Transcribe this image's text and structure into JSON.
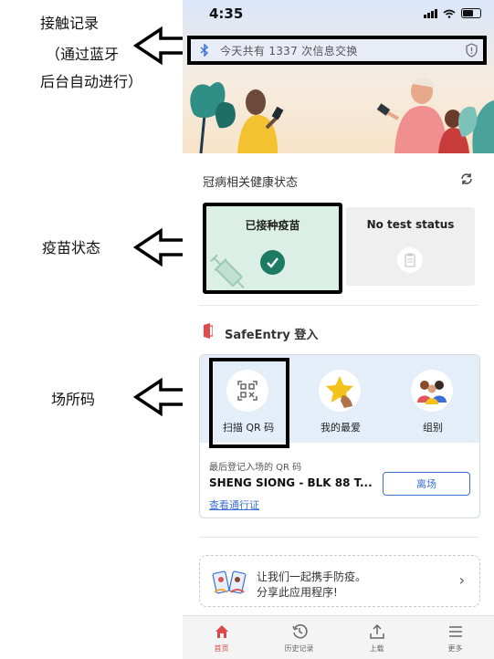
{
  "annotations": {
    "contact_line1": "接触记录",
    "contact_line2": "（通过蓝牙",
    "contact_line3": "后台自动进行）",
    "vaccine": "疫苗状态",
    "venue": "场所码"
  },
  "statusbar": {
    "time": "4:35"
  },
  "exchange": {
    "text": "今天共有 1337 次信息交换"
  },
  "health": {
    "title": "冠病相关健康状态",
    "vaccinated_label": "已接种疫苗",
    "test_label": "No test status"
  },
  "safeentry": {
    "title": "SafeEntry 登入",
    "items": [
      {
        "label": "扫描 QR 码"
      },
      {
        "label": "我的最爱"
      },
      {
        "label": "组别"
      }
    ],
    "last_label": "最后登记入场的 QR 码",
    "last_place": "SHENG SIONG - BLK 88 T...",
    "leave_button": "离场",
    "pass_link": "查看通行证"
  },
  "share": {
    "line1": "让我们一起携手防疫。",
    "line2": "分享此应用程序!",
    "chevron": "›"
  },
  "tabbar": {
    "items": [
      {
        "label": "首页",
        "icon": "home-icon"
      },
      {
        "label": "历史记录",
        "icon": "history-icon"
      },
      {
        "label": "上载",
        "icon": "upload-icon"
      },
      {
        "label": "更多",
        "icon": "menu-icon"
      }
    ]
  },
  "colors": {
    "accent": "#3a6fd8",
    "vaccinated": "#1d7a63",
    "active_tab": "#d94a4a"
  }
}
